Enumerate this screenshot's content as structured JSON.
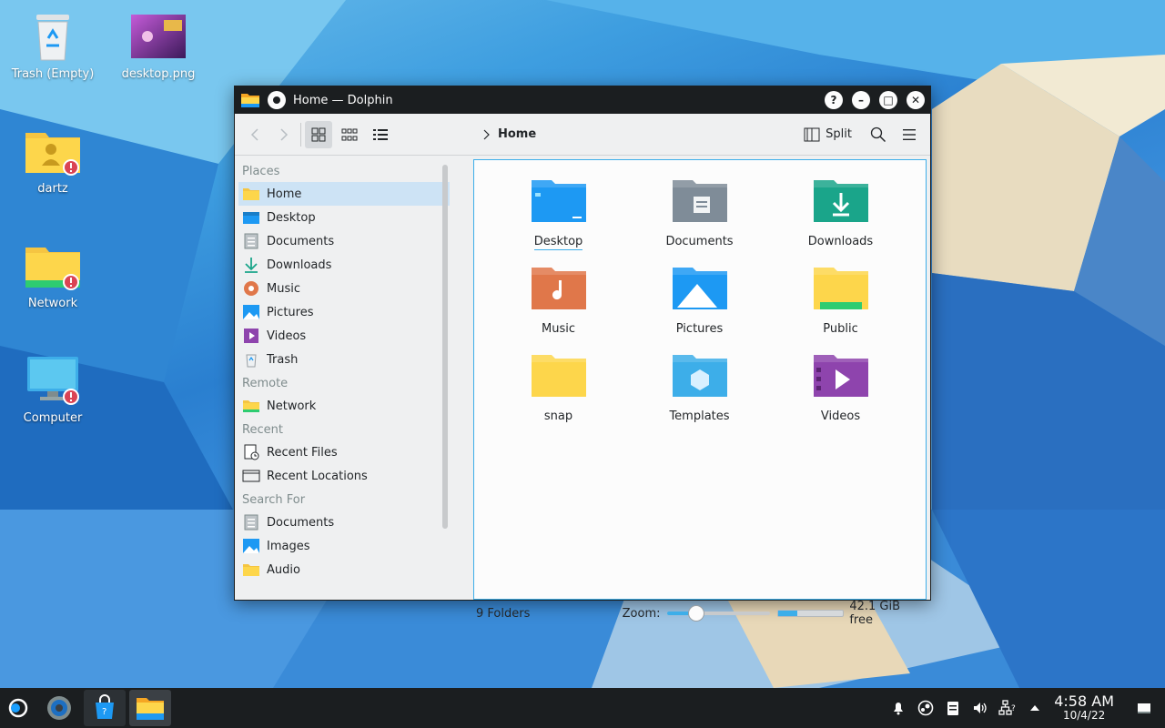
{
  "desktop": {
    "icons": [
      {
        "label": "Trash (Empty)",
        "icon": "trash-icon"
      },
      {
        "label": "desktop.png",
        "icon": "image-thumbnail"
      },
      {
        "label": "dartz",
        "icon": "user-folder-icon"
      },
      {
        "label": "Network",
        "icon": "network-folder-icon"
      },
      {
        "label": "Computer",
        "icon": "computer-icon"
      }
    ]
  },
  "window": {
    "title": "Home — Dolphin",
    "buttons": {
      "help": "?",
      "minimize": "–",
      "maximize": "□",
      "close": "✕"
    }
  },
  "toolbar": {
    "breadcrumb": "Home",
    "split_label": "Split"
  },
  "sidebar": {
    "sections": [
      {
        "title": "Places",
        "items": [
          {
            "label": "Home",
            "icon": "home-folder-icon",
            "selected": true
          },
          {
            "label": "Desktop",
            "icon": "desktop-folder-icon"
          },
          {
            "label": "Documents",
            "icon": "documents-icon"
          },
          {
            "label": "Downloads",
            "icon": "downloads-icon"
          },
          {
            "label": "Music",
            "icon": "music-icon"
          },
          {
            "label": "Pictures",
            "icon": "pictures-icon"
          },
          {
            "label": "Videos",
            "icon": "videos-icon"
          },
          {
            "label": "Trash",
            "icon": "trash-icon"
          }
        ]
      },
      {
        "title": "Remote",
        "items": [
          {
            "label": "Network",
            "icon": "network-folder-icon"
          }
        ]
      },
      {
        "title": "Recent",
        "items": [
          {
            "label": "Recent Files",
            "icon": "recent-files-icon"
          },
          {
            "label": "Recent Locations",
            "icon": "recent-locations-icon"
          }
        ]
      },
      {
        "title": "Search For",
        "items": [
          {
            "label": "Documents",
            "icon": "documents-icon"
          },
          {
            "label": "Images",
            "icon": "images-icon"
          },
          {
            "label": "Audio",
            "icon": "audio-folder-icon"
          }
        ]
      }
    ]
  },
  "files": [
    {
      "label": "Desktop",
      "icon": "desktop-folder-icon",
      "color": "#1d99f3"
    },
    {
      "label": "Documents",
      "icon": "documents-folder-icon",
      "color": "#7f8c98"
    },
    {
      "label": "Downloads",
      "icon": "downloads-folder-icon",
      "color": "#1aa58a"
    },
    {
      "label": "Music",
      "icon": "music-folder-icon",
      "color": "#e0774a"
    },
    {
      "label": "Pictures",
      "icon": "pictures-folder-icon",
      "color": "#1d99f3"
    },
    {
      "label": "Public",
      "icon": "public-folder-icon",
      "color": "#fdd64b"
    },
    {
      "label": "snap",
      "icon": "folder-icon",
      "color": "#fdd64b"
    },
    {
      "label": "Templates",
      "icon": "templates-folder-icon",
      "color": "#3daee9"
    },
    {
      "label": "Videos",
      "icon": "videos-folder-icon",
      "color": "#8e44ad"
    }
  ],
  "status": {
    "count": "9 Folders",
    "zoom_label": "Zoom:",
    "zoom_level": 0.28,
    "free_label": "42.1 GiB free",
    "used_fraction": 0.3
  },
  "taskbar": {
    "time": "4:58 AM",
    "date": "10/4/22"
  }
}
